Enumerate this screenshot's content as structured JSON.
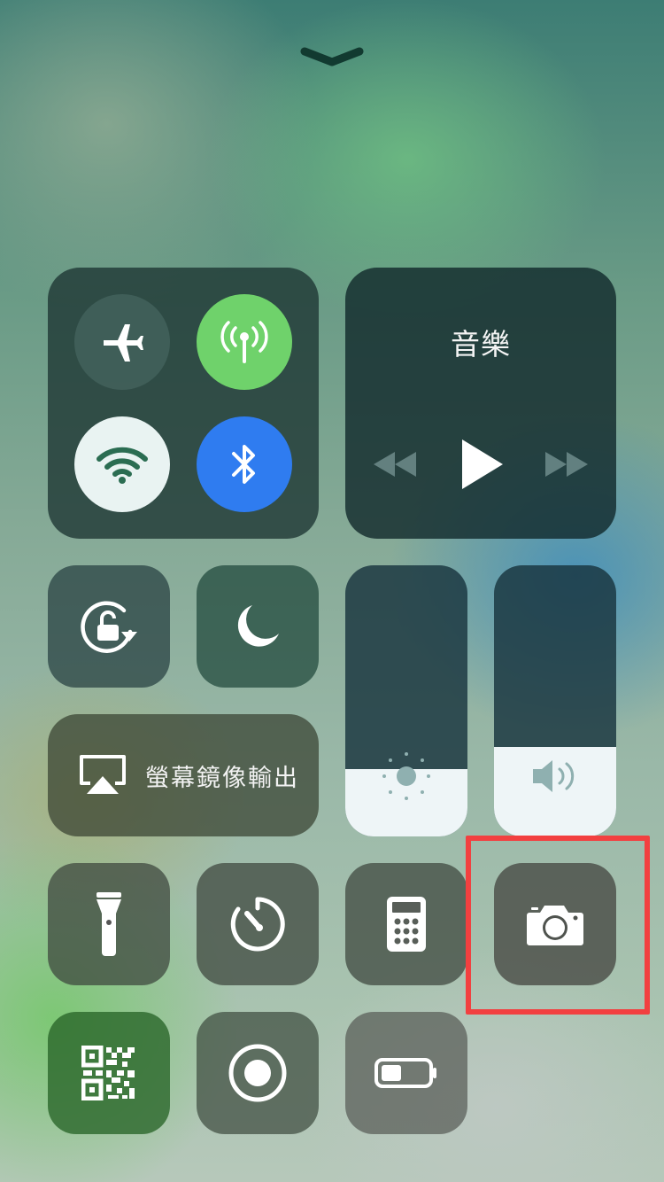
{
  "top": {
    "dismiss_icon": "chevron-down-icon"
  },
  "connectivity": {
    "airplane": {
      "icon": "airplane-icon",
      "on": false
    },
    "cellular": {
      "icon": "cellular-antenna-icon",
      "on": true,
      "color": "#6fd26b"
    },
    "wifi": {
      "icon": "wifi-icon",
      "on": true
    },
    "bluetooth": {
      "icon": "bluetooth-icon",
      "on": true,
      "color": "#2f7cf0"
    }
  },
  "music": {
    "title": "音樂",
    "controls": [
      "rewind-icon",
      "play-icon",
      "fast-forward-icon"
    ]
  },
  "toggles": [
    {
      "name": "orientation-lock",
      "icon": "rotation-lock-icon"
    },
    {
      "name": "do-not-disturb",
      "icon": "moon-icon"
    }
  ],
  "screen_mirroring": {
    "label": "螢幕鏡像輸出",
    "icon": "airplay-icon"
  },
  "brightness": {
    "icon": "sun-icon",
    "level": 0.25
  },
  "volume": {
    "icon": "speaker-icon",
    "level": 0.33
  },
  "shortcuts": [
    {
      "name": "flashlight",
      "icon": "flashlight-icon"
    },
    {
      "name": "timer",
      "icon": "timer-icon"
    },
    {
      "name": "calculator",
      "icon": "calculator-icon"
    },
    {
      "name": "camera",
      "icon": "camera-icon",
      "highlighted": true
    },
    {
      "name": "qr-scanner",
      "icon": "qr-code-icon"
    },
    {
      "name": "screen-recording",
      "icon": "record-icon"
    },
    {
      "name": "low-power-mode",
      "icon": "battery-icon"
    }
  ],
  "colors": {
    "highlight": "#f24040"
  }
}
